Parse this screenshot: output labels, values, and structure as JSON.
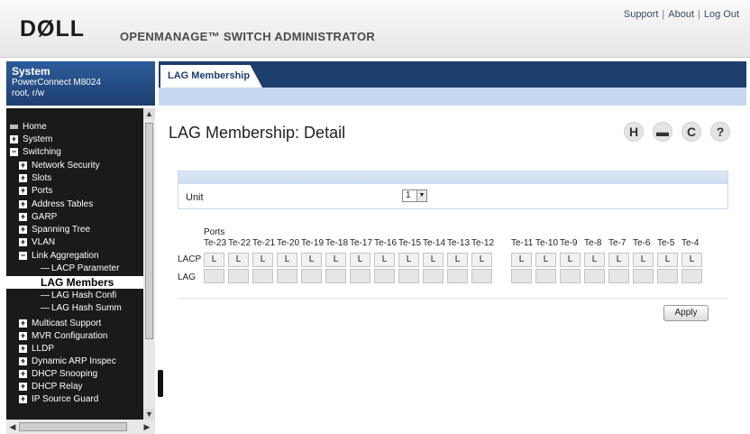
{
  "header": {
    "logo": "DØLL",
    "title": "OPENMANAGE™ SWITCH ADMINISTRATOR",
    "links": [
      "Support",
      "About",
      "Log Out"
    ]
  },
  "system_info": {
    "title": "System",
    "model": "PowerConnect M8024",
    "user": "root, r/w"
  },
  "nav": {
    "items": [
      {
        "label": "Home",
        "icon": "home-icon"
      },
      {
        "label": "System",
        "icon": "expand-icon"
      },
      {
        "label": "Switching",
        "icon": "collapse-icon"
      },
      {
        "label": "Network Security",
        "icon": "expand-icon"
      },
      {
        "label": "Slots",
        "icon": "expand-icon"
      },
      {
        "label": "Ports",
        "icon": "expand-icon"
      },
      {
        "label": "Address Tables",
        "icon": "expand-icon"
      },
      {
        "label": "GARP",
        "icon": "expand-icon"
      },
      {
        "label": "Spanning Tree",
        "icon": "expand-icon"
      },
      {
        "label": "VLAN",
        "icon": "expand-icon"
      },
      {
        "label": "Link Aggregation",
        "icon": "collapse-icon"
      },
      {
        "label": "LACP Parameter",
        "icon": "leaf"
      },
      {
        "label": "LAG Members",
        "icon": "leaf",
        "selected": true
      },
      {
        "label": "LAG Hash Confi",
        "icon": "leaf"
      },
      {
        "label": "LAG Hash Summ",
        "icon": "leaf"
      },
      {
        "label": "Multicast Support",
        "icon": "expand-icon"
      },
      {
        "label": "MVR Configuration",
        "icon": "expand-icon"
      },
      {
        "label": "LLDP",
        "icon": "expand-icon"
      },
      {
        "label": "Dynamic ARP Inspec",
        "icon": "expand-icon"
      },
      {
        "label": "DHCP Snooping",
        "icon": "expand-icon"
      },
      {
        "label": "DHCP Relay",
        "icon": "expand-icon"
      },
      {
        "label": "IP Source Guard",
        "icon": "expand-icon"
      }
    ]
  },
  "tab": {
    "label": "LAG Membership"
  },
  "page": {
    "title": "LAG Membership: Detail"
  },
  "toolbar_icons": [
    {
      "name": "save-icon",
      "glyph": "H"
    },
    {
      "name": "print-icon",
      "glyph": "▬"
    },
    {
      "name": "refresh-icon",
      "glyph": "C"
    },
    {
      "name": "help-icon",
      "glyph": "?"
    }
  ],
  "unit": {
    "label": "Unit",
    "value": "1"
  },
  "ports": {
    "header": "Ports",
    "row_lacp": "LACP",
    "row_lag": "LAG",
    "cell_value": "L",
    "group1": [
      "Te-23",
      "Te-22",
      "Te-21",
      "Te-20",
      "Te-19",
      "Te-18",
      "Te-17",
      "Te-16",
      "Te-15",
      "Te-14",
      "Te-13",
      "Te-12"
    ],
    "group2": [
      "Te-11",
      "Te-10",
      "Te-9",
      "Te-8",
      "Te-7",
      "Te-6",
      "Te-5",
      "Te-4"
    ]
  },
  "apply_label": "Apply"
}
